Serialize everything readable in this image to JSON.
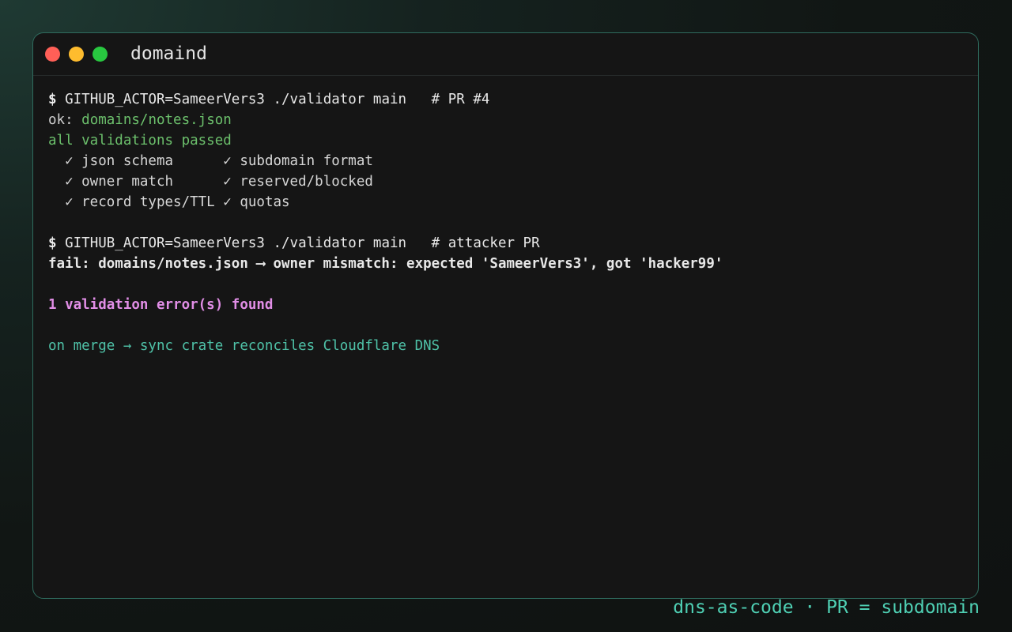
{
  "window": {
    "title": "domaind"
  },
  "terminal": {
    "run1": {
      "prompt": "$",
      "command": " GITHUB_ACTOR=SameerVers3 ./validator main   # PR #4"
    },
    "ok_prefix": "ok: ",
    "ok_path": "domains/notes.json",
    "passed": "all validations passed",
    "checks": [
      [
        "  ✓ json schema      ",
        "✓ subdomain format"
      ],
      [
        "  ✓ owner match      ",
        "✓ reserved/blocked"
      ],
      [
        "  ✓ record types/TTL ",
        "✓ quotas"
      ]
    ],
    "run2": {
      "prompt": "$",
      "command": " GITHUB_ACTOR=SameerVers3 ./validator main   # attacker PR"
    },
    "fail_line": "fail: domains/notes.json ⟶ owner mismatch: expected 'SameerVers3', got 'hacker99'",
    "error_summary": "1 validation error(s) found",
    "merge_note": "on merge → sync crate reconciles Cloudflare DNS"
  },
  "footer": {
    "caption": "dns-as-code · PR = subdomain"
  },
  "colors": {
    "accent": "#4fc2a8",
    "success": "#6cc06c",
    "error": "#e18ee6",
    "window_border": "#2f6b5e",
    "dot_red": "#ff5f57",
    "dot_yellow": "#febc2e",
    "dot_green": "#28c840"
  }
}
